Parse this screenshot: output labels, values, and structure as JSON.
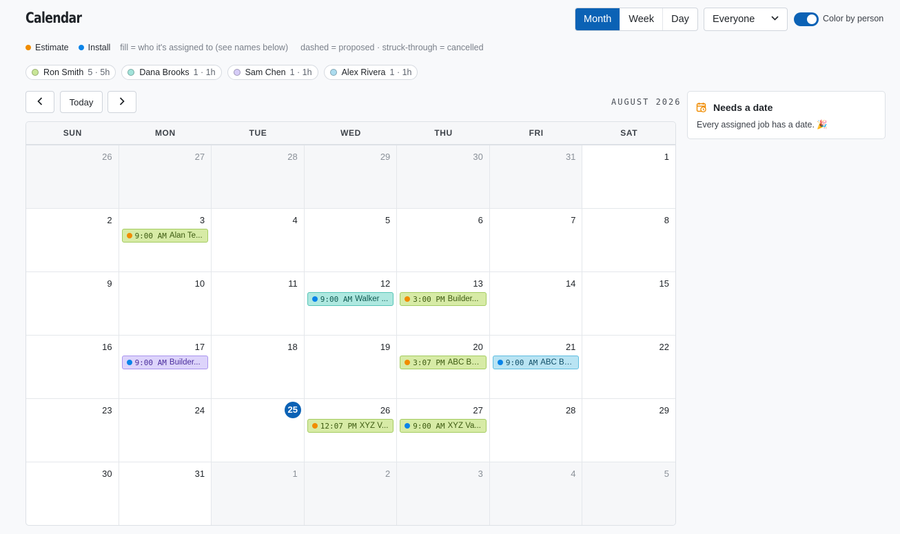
{
  "app": {
    "title": "Calendar"
  },
  "views": [
    {
      "label": "Month",
      "active": true
    },
    {
      "label": "Week",
      "active": false
    },
    {
      "label": "Day",
      "active": false
    }
  ],
  "person_filter": {
    "selected": "Everyone"
  },
  "color_toggle": {
    "label": "Color by person",
    "on": true
  },
  "legend": {
    "estimate": {
      "label": "Estimate",
      "color": "#f08c00"
    },
    "install": {
      "label": "Install",
      "color": "#0b84e8"
    },
    "fill_hint": "fill = who it's assigned to (see names below)",
    "style_hint": "dashed = proposed · struck-through = cancelled"
  },
  "people": [
    {
      "name": "Ron Smith",
      "stat": "5 · 5h",
      "color": "#c9e697"
    },
    {
      "name": "Dana Brooks",
      "stat": "1 · 1h",
      "color": "#a2e3da"
    },
    {
      "name": "Sam Chen",
      "stat": "1 · 1h",
      "color": "#d6ccf7"
    },
    {
      "name": "Alex Rivera",
      "stat": "1 · 1h",
      "color": "#acdcef"
    }
  ],
  "nav": {
    "today_label": "Today",
    "prev_icon": "chevron-left-icon",
    "next_icon": "chevron-right-icon"
  },
  "month_label": "AUGUST 2026",
  "weekdays": [
    "SUN",
    "MON",
    "TUE",
    "WED",
    "THU",
    "FRI",
    "SAT"
  ],
  "days": [
    {
      "num": "26",
      "out": true
    },
    {
      "num": "27",
      "out": true
    },
    {
      "num": "28",
      "out": true
    },
    {
      "num": "29",
      "out": true
    },
    {
      "num": "30",
      "out": true
    },
    {
      "num": "31",
      "out": true
    },
    {
      "num": "1"
    },
    {
      "num": "2"
    },
    {
      "num": "3",
      "event": {
        "time": "9:00 AM",
        "title": "Alan Te...",
        "kind": "estimate",
        "person": "ron"
      }
    },
    {
      "num": "4"
    },
    {
      "num": "5"
    },
    {
      "num": "6"
    },
    {
      "num": "7"
    },
    {
      "num": "8"
    },
    {
      "num": "9"
    },
    {
      "num": "10"
    },
    {
      "num": "11"
    },
    {
      "num": "12",
      "event": {
        "time": "9:00 AM",
        "title": "Walker ...",
        "kind": "install",
        "person": "dana"
      }
    },
    {
      "num": "13",
      "event": {
        "time": "3:00 PM",
        "title": "Builder...",
        "kind": "estimate",
        "person": "ron"
      }
    },
    {
      "num": "14"
    },
    {
      "num": "15"
    },
    {
      "num": "16"
    },
    {
      "num": "17",
      "event": {
        "time": "9:00 AM",
        "title": "Builder...",
        "kind": "install",
        "person": "sam"
      }
    },
    {
      "num": "18"
    },
    {
      "num": "19"
    },
    {
      "num": "20",
      "event": {
        "time": "3:07 PM",
        "title": "ABC Ba...",
        "kind": "estimate",
        "person": "ron"
      }
    },
    {
      "num": "21",
      "event": {
        "time": "9:00 AM",
        "title": "ABC Ba...",
        "kind": "install",
        "person": "alex"
      }
    },
    {
      "num": "22"
    },
    {
      "num": "23"
    },
    {
      "num": "24"
    },
    {
      "num": "25",
      "today": true
    },
    {
      "num": "26",
      "event": {
        "time": "12:07 PM",
        "title": "XYZ V...",
        "kind": "estimate",
        "person": "ron"
      }
    },
    {
      "num": "27",
      "event": {
        "time": "9:00 AM",
        "title": "XYZ Va...",
        "kind": "install",
        "person": "ron"
      }
    },
    {
      "num": "28"
    },
    {
      "num": "29"
    },
    {
      "num": "30"
    },
    {
      "num": "31"
    },
    {
      "num": "1",
      "out": true
    },
    {
      "num": "2",
      "out": true
    },
    {
      "num": "3",
      "out": true
    },
    {
      "num": "4",
      "out": true
    },
    {
      "num": "5",
      "out": true
    }
  ],
  "needs_date": {
    "title": "Needs a date",
    "text": "Every assigned job has a date. 🎉",
    "icon": "calendar-clock-icon",
    "icon_color": "#f08c00"
  }
}
